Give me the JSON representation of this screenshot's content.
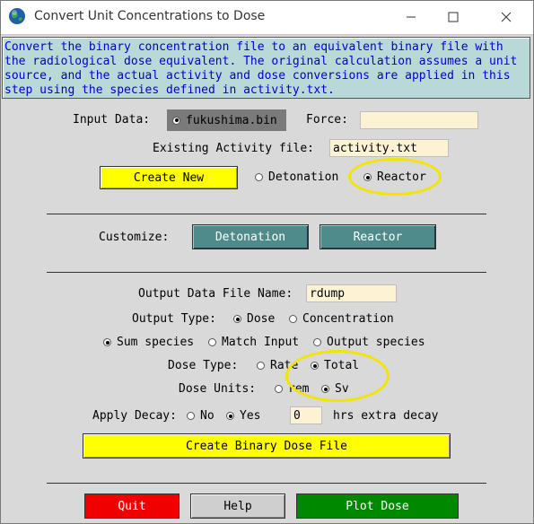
{
  "window": {
    "title": "Convert Unit Concentrations to Dose"
  },
  "description": "Convert the binary concentration file to an equivalent binary file with the radiological dose equivalent. The original calculation assumes a unit source, and the actual activity and dose conversions are applied in this step using the species defined in activity.txt.",
  "input": {
    "label": "Input Data:",
    "file": "fukushima.bin",
    "force_label": "Force:",
    "force_value": ""
  },
  "activity": {
    "label": "Existing Activity file:",
    "value": "activity.txt",
    "create_new": "Create New",
    "option_detonation": "Detonation",
    "option_reactor": "Reactor",
    "selected": "Reactor"
  },
  "customize": {
    "label": "Customize:",
    "detonation": "Detonation",
    "reactor": "Reactor"
  },
  "output": {
    "file_label": "Output Data File Name:",
    "file_value": "rdump",
    "type_label": "Output Type:",
    "type_dose": "Dose",
    "type_concentration": "Concentration",
    "type_selected": "Dose",
    "species_sum": "Sum species",
    "species_match": "Match Input",
    "species_output": "Output species",
    "species_selected": "Sum species",
    "dose_type_label": "Dose Type:",
    "dose_rate": "Rate",
    "dose_total": "Total",
    "dose_type_selected": "Total",
    "dose_units_label": "Dose Units:",
    "units_rem": "rem",
    "units_sv": "Sv",
    "units_selected": "Sv",
    "decay_label": "Apply Decay:",
    "decay_no": "No",
    "decay_yes": "Yes",
    "decay_selected": "Yes",
    "decay_value": "0",
    "decay_suffix": "hrs extra decay",
    "create_button": "Create Binary Dose File"
  },
  "footer": {
    "quit": "Quit",
    "help": "Help",
    "plot": "Plot Dose"
  },
  "colors": {
    "yellow": "#ffff00",
    "teal": "#4f8b8b",
    "red": "#f00000",
    "green": "#008800",
    "highlight": "#f2e600"
  }
}
